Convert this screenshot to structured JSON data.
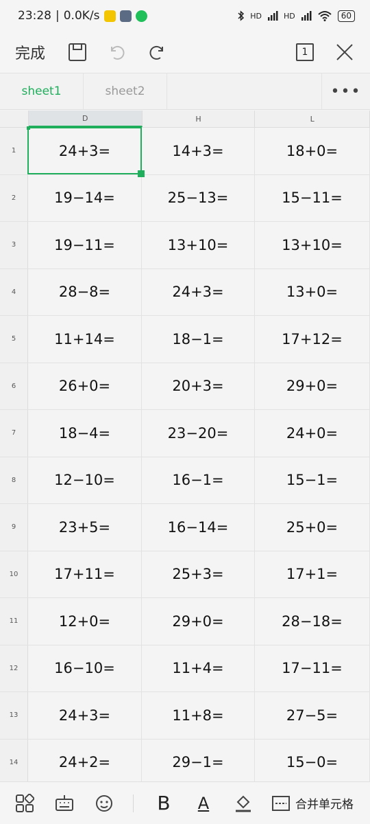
{
  "status_bar": {
    "time": "23:28",
    "speed": "0.0K/s",
    "battery": "60",
    "signal_label": "HD"
  },
  "toolbar": {
    "done_label": "完成",
    "page_count": "1"
  },
  "tabs": [
    {
      "label": "sheet1",
      "active": true
    },
    {
      "label": "sheet2",
      "active": false
    }
  ],
  "more_label": "•••",
  "columns": [
    "D",
    "H",
    "L"
  ],
  "rows": [
    {
      "num": "1",
      "cells": [
        "24+3=",
        "14+3=",
        "18+0="
      ]
    },
    {
      "num": "2",
      "cells": [
        "19−14=",
        "25−13=",
        "15−11="
      ]
    },
    {
      "num": "3",
      "cells": [
        "19−11=",
        "13+10=",
        "13+10="
      ]
    },
    {
      "num": "4",
      "cells": [
        "28−8=",
        "24+3=",
        "13+0="
      ]
    },
    {
      "num": "5",
      "cells": [
        "11+14=",
        "18−1=",
        "17+12="
      ]
    },
    {
      "num": "6",
      "cells": [
        "26+0=",
        "20+3=",
        "29+0="
      ]
    },
    {
      "num": "7",
      "cells": [
        "18−4=",
        "23−20=",
        "24+0="
      ]
    },
    {
      "num": "8",
      "cells": [
        "12−10=",
        "16−1=",
        "15−1="
      ]
    },
    {
      "num": "9",
      "cells": [
        "23+5=",
        "16−14=",
        "25+0="
      ]
    },
    {
      "num": "10",
      "cells": [
        "17+11=",
        "25+3=",
        "17+1="
      ]
    },
    {
      "num": "11",
      "cells": [
        "12+0=",
        "29+0=",
        "28−18="
      ]
    },
    {
      "num": "12",
      "cells": [
        "16−10=",
        "11+4=",
        "17−11="
      ]
    },
    {
      "num": "13",
      "cells": [
        "24+3=",
        "11+8=",
        "27−5="
      ]
    },
    {
      "num": "14",
      "cells": [
        "24+2=",
        "29−1=",
        "15−0="
      ]
    }
  ],
  "bottom_bar": {
    "bold_label": "B",
    "font_color_label": "A",
    "merge_label": "合并单元格"
  },
  "colors": {
    "accent": "#1fae5c"
  }
}
